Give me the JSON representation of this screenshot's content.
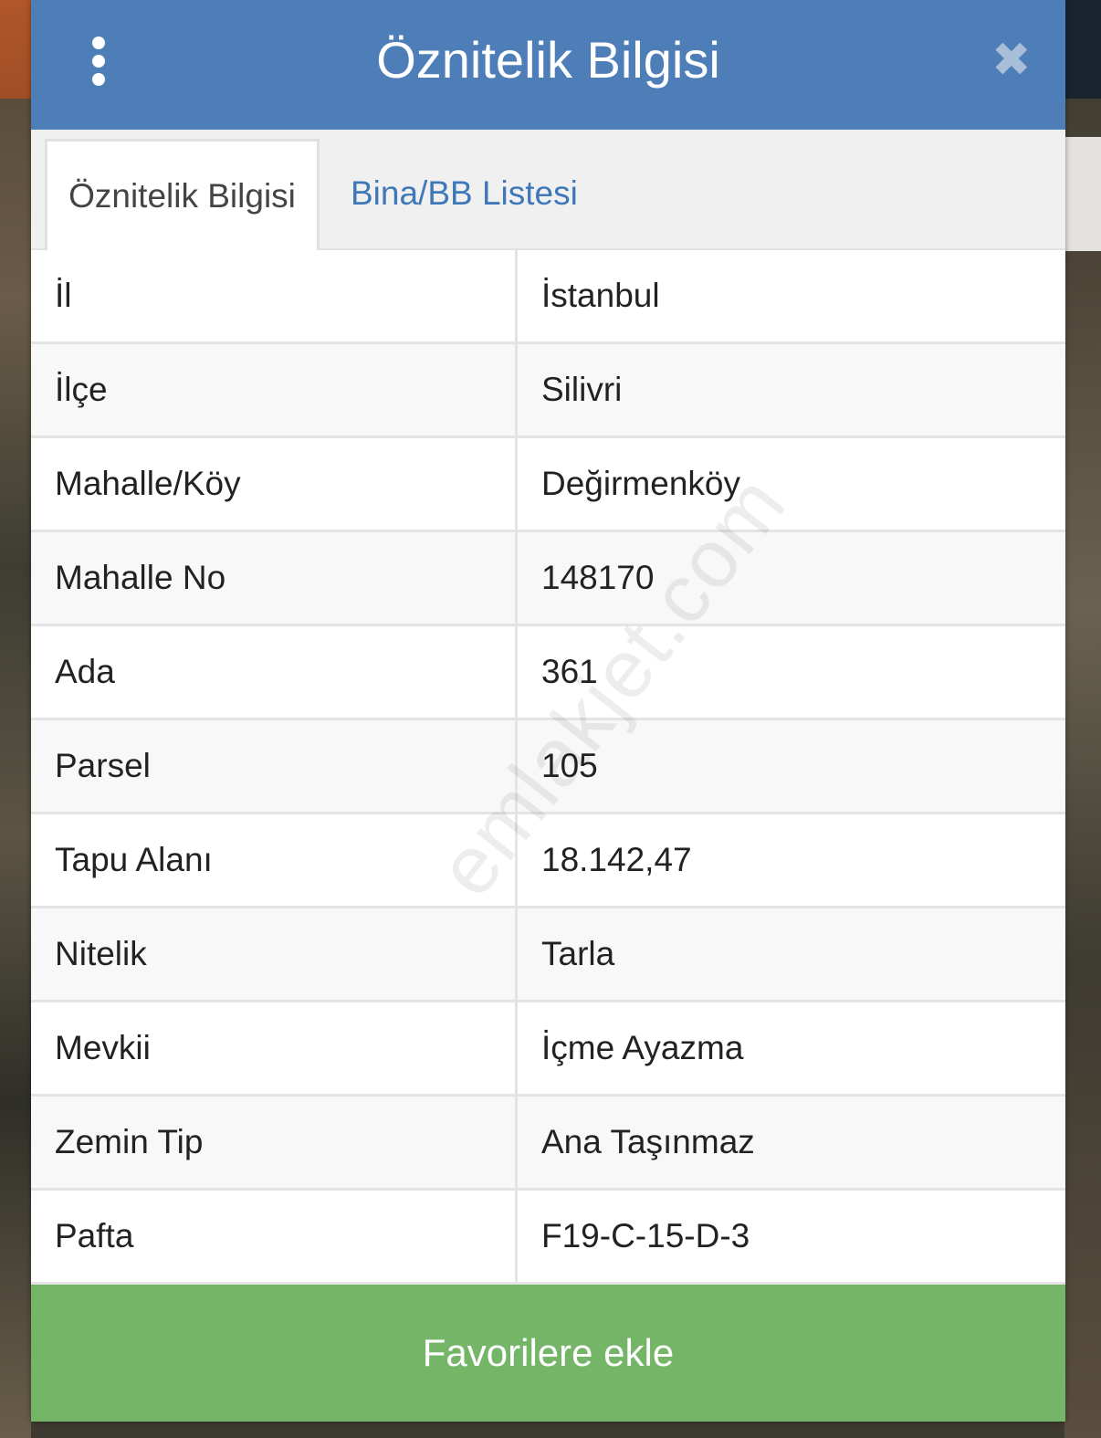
{
  "header": {
    "title": "Öznitelik Bilgisi",
    "menu_icon": "more-vertical-icon",
    "close_icon": "close-icon"
  },
  "tabs": [
    {
      "label": "Öznitelik Bilgisi",
      "active": true
    },
    {
      "label": "Bina/BB Listesi",
      "active": false
    }
  ],
  "rows": [
    {
      "key": "İl",
      "value": "İstanbul"
    },
    {
      "key": "İlçe",
      "value": "Silivri"
    },
    {
      "key": "Mahalle/Köy",
      "value": "Değirmenköy"
    },
    {
      "key": "Mahalle No",
      "value": "148170"
    },
    {
      "key": "Ada",
      "value": "361"
    },
    {
      "key": "Parsel",
      "value": "105"
    },
    {
      "key": "Tapu Alanı",
      "value": "18.142,47"
    },
    {
      "key": "Nitelik",
      "value": "Tarla"
    },
    {
      "key": "Mevkii",
      "value": "İçme Ayazma"
    },
    {
      "key": "Zemin Tip",
      "value": "Ana Taşınmaz"
    },
    {
      "key": "Pafta",
      "value": "F19-C-15-D-3"
    }
  ],
  "footer": {
    "favorite_label": "Favorilere ekle"
  },
  "watermark": "emlakjet.com",
  "colors": {
    "header_bg": "#4d7eb8",
    "tab_link": "#3f78b8",
    "favorite_bg": "#74b567"
  }
}
